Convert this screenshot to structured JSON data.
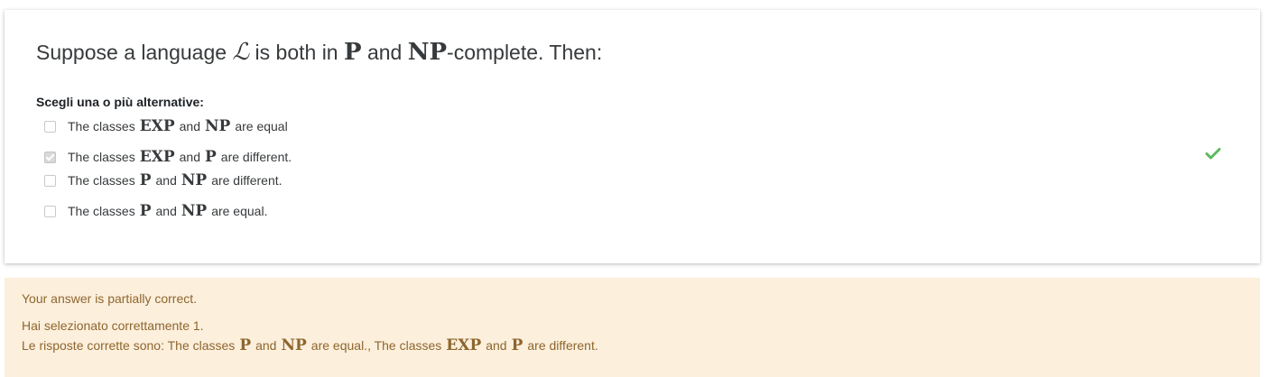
{
  "question": {
    "prefix": "Suppose a language",
    "lang_symbol": "ℒ",
    "mid1": "is both in",
    "class_p": "P",
    "mid2": "and",
    "class_np": "NP",
    "suffix": "-complete. Then:"
  },
  "prompt": "Scegli una o più alternative:",
  "options": [
    {
      "pre": "The classes",
      "a": "EXP",
      "and": "and",
      "b": "NP",
      "post": "are equal",
      "checked": false
    },
    {
      "pre": "The classes",
      "a": "EXP",
      "and": "and",
      "b": "P",
      "post": "are different.",
      "checked": true
    },
    {
      "pre": "The classes",
      "a": "P",
      "and": "and",
      "b": "NP",
      "post": "are different.",
      "checked": false
    },
    {
      "pre": "The classes",
      "a": "P",
      "and": "and",
      "b": "NP",
      "post": "are equal.",
      "checked": false
    }
  ],
  "correct_icon": "check-icon",
  "feedback": {
    "status": "Your answer is partially correct.",
    "selected": "Hai selezionato correttamente 1.",
    "answers_prefix": "Le risposte corrette sono: The classes",
    "a1": "P",
    "and1": "and",
    "b1": "NP",
    "mid": "are equal., The classes",
    "a2": "EXP",
    "and2": "and",
    "b2": "P",
    "end": "are different."
  },
  "colors": {
    "feedback_bg": "#fcefdc",
    "feedback_text": "#8e662e",
    "correct_green": "#5cb85c"
  }
}
